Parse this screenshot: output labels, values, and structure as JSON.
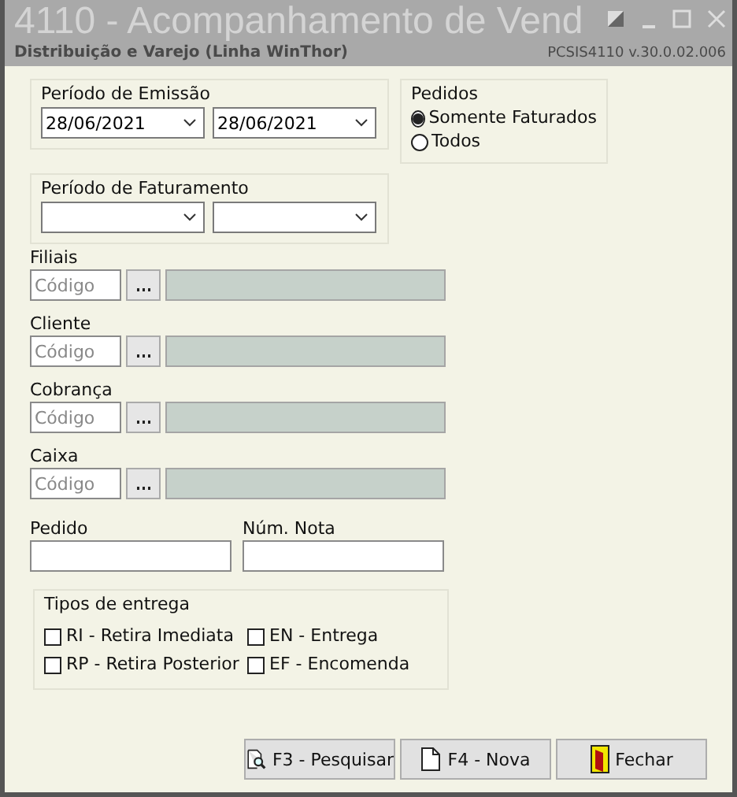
{
  "window": {
    "title": "4110 - Acompanhamento de Vend",
    "subtitle": "Distribuição e Varejo (Linha WinThor)",
    "version": "PCSIS4110  v.30.0.02.006"
  },
  "emissao": {
    "label": "Período de Emissão",
    "from": "28/06/2021",
    "to": "28/06/2021"
  },
  "pedidos": {
    "label": "Pedidos",
    "options": [
      {
        "label": "Somente Faturados",
        "selected": true
      },
      {
        "label": "Todos",
        "selected": false
      }
    ]
  },
  "faturamento": {
    "label": "Período de Faturamento"
  },
  "lookups": [
    {
      "label": "Filiais",
      "placeholder": "Código"
    },
    {
      "label": "Cliente",
      "placeholder": "Código"
    },
    {
      "label": "Cobrança",
      "placeholder": "Código"
    },
    {
      "label": "Caixa",
      "placeholder": "Código"
    }
  ],
  "pedido": {
    "label": "Pedido"
  },
  "num_nota": {
    "label": "Núm. Nota"
  },
  "tipos": {
    "label": "Tipos de entrega",
    "options": [
      {
        "label": "RI - Retira Imediata",
        "checked": false
      },
      {
        "label": "EN - Entrega",
        "checked": false
      },
      {
        "label": "RP - Retira Posterior",
        "checked": false
      },
      {
        "label": "EF - Encomenda",
        "checked": false
      }
    ]
  },
  "buttons": [
    {
      "label": "F3 - Pesquisar",
      "kind": "search"
    },
    {
      "label": "F4 - Nova",
      "kind": "new"
    },
    {
      "label": "Fechar",
      "kind": "close"
    }
  ]
}
